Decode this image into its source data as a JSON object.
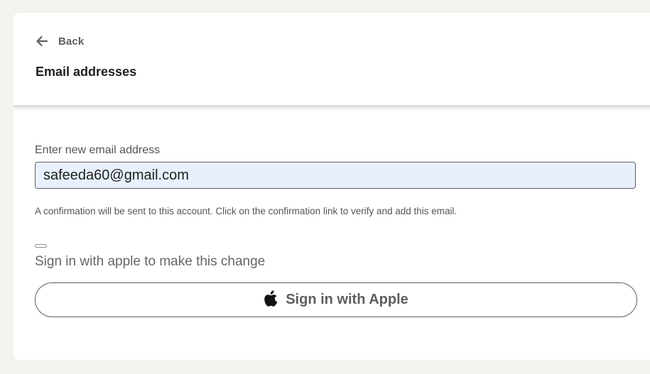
{
  "header": {
    "back_label": "Back",
    "title": "Email addresses"
  },
  "email_form": {
    "field_label": "Enter new email address",
    "email_value": "safeeda60@gmail.com",
    "helper_text": "A confirmation will be sent to this account. Click on the confirmation link to verify and add this email."
  },
  "signin": {
    "prompt": "Sign in with apple to make this change",
    "button_label": "Sign in with Apple"
  },
  "icons": {
    "back": "arrow-left-icon",
    "apple": "apple-logo-icon"
  },
  "colors": {
    "page_background": "#f3f2ee",
    "card_background": "#ffffff",
    "input_fill": "#e8f0fe",
    "secondary_text": "#5e5e5e"
  }
}
